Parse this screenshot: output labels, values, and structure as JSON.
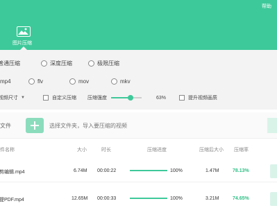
{
  "header": {
    "help": "帮助",
    "tool_label": "图片压缩",
    "tool_icon": "image-icon",
    "accent": "#3ec99a"
  },
  "compress_modes": [
    "普通压缩",
    "深度压缩",
    "极限压缩"
  ],
  "formats": [
    "mp4",
    "flv",
    "mov",
    "mkv"
  ],
  "settings": {
    "size_select": "视频尺寸",
    "custom_compress": "自定义压缩",
    "strength_label": "压缩强度",
    "strength_value": "63%",
    "strength_fraction": 0.63,
    "enhance_quality": "提升视频画质"
  },
  "add_bar": {
    "left_label": "文件",
    "hint": "选择文件夹，导入要压缩的视频"
  },
  "table": {
    "headers": [
      "件名称",
      "大小",
      "时长",
      "压缩进度",
      "压缩后大小",
      "压缩率"
    ],
    "rows": [
      {
        "name": "剪编辑.mp4",
        "size": "6.74M",
        "duration": "00:00:22",
        "progress": "100%",
        "progress_fraction": 1.0,
        "after": "1.47M",
        "ratio": "78.13%"
      },
      {
        "name": "提PDF.mp4",
        "size": "12.65M",
        "duration": "00:00:33",
        "progress": "100%",
        "progress_fraction": 1.0,
        "after": "3.21M",
        "ratio": "74.65%"
      }
    ]
  }
}
